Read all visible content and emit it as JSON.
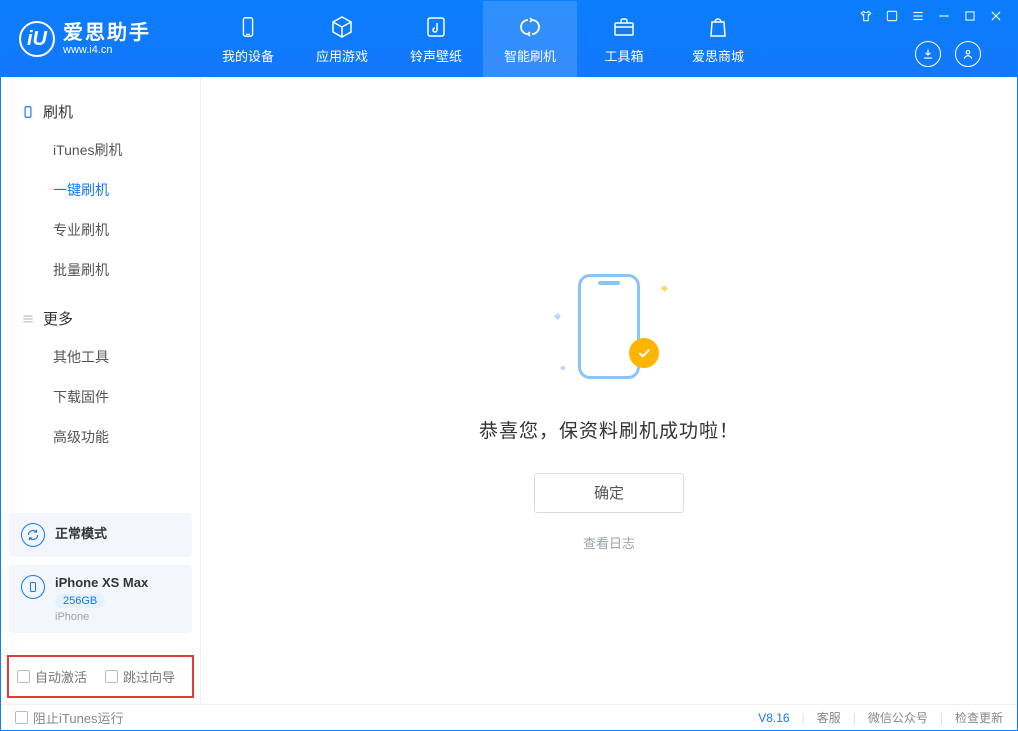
{
  "app": {
    "name": "爱思助手",
    "url": "www.i4.cn",
    "logo_letter": "iU"
  },
  "tabs": [
    {
      "label": "我的设备",
      "icon": "device"
    },
    {
      "label": "应用游戏",
      "icon": "cube"
    },
    {
      "label": "铃声壁纸",
      "icon": "music"
    },
    {
      "label": "智能刷机",
      "icon": "refresh",
      "active": true
    },
    {
      "label": "工具箱",
      "icon": "toolbox"
    },
    {
      "label": "爱思商城",
      "icon": "bag"
    }
  ],
  "sidebar": {
    "sections": [
      {
        "title": "刷机",
        "icon": "phone",
        "items": [
          "iTunes刷机",
          "一键刷机",
          "专业刷机",
          "批量刷机"
        ],
        "active_index": 1
      },
      {
        "title": "更多",
        "icon": "menu",
        "items": [
          "其他工具",
          "下载固件",
          "高级功能"
        ]
      }
    ]
  },
  "device_cards": [
    {
      "title": "正常模式",
      "icon": "reload"
    },
    {
      "title": "iPhone XS Max",
      "badge": "256GB",
      "sub": "iPhone",
      "icon": "phone"
    }
  ],
  "bottom_options": {
    "opt1": "自动激活",
    "opt2": "跳过向导"
  },
  "main": {
    "title": "恭喜您，保资料刷机成功啦！",
    "ok": "确定",
    "log_link": "查看日志"
  },
  "statusbar": {
    "block_itunes": "阻止iTunes运行",
    "version": "V8.16",
    "links": [
      "客服",
      "微信公众号",
      "检查更新"
    ]
  }
}
